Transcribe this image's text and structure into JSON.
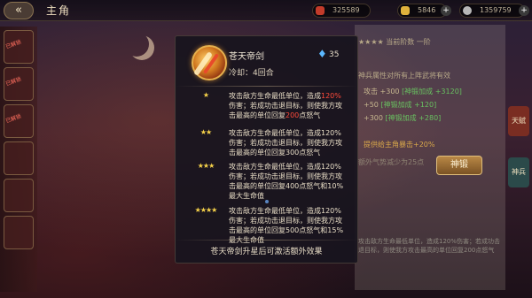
{
  "header": {
    "back_icon": "back-arrow-icon",
    "title": "主角",
    "resources": [
      {
        "name": "power",
        "value": "325589",
        "color": "#c23b2a"
      },
      {
        "name": "gold",
        "value": "5846",
        "color": "#e0b23c"
      },
      {
        "name": "silver",
        "value": "1359759",
        "color": "#b7b7b7"
      }
    ]
  },
  "left_tabs": [
    {
      "tag": "已解锁"
    },
    {
      "tag": "已解锁"
    },
    {
      "tag": "已解锁"
    },
    {
      "tag": ""
    },
    {
      "tag": ""
    },
    {
      "tag": ""
    }
  ],
  "right_panel": {
    "header": "★★★★  当前阶数  一阶",
    "attr_title": "神兵属性对所有上阵武将有效",
    "rows": [
      {
        "label": "攻击 +300",
        "bonus": "[神锻加成 +3120]"
      },
      {
        "label": "+50",
        "bonus": "[神锻加成 +120]"
      },
      {
        "label": "+300",
        "bonus": "[神锻加成 +280]"
      }
    ],
    "note1": "提供给主角暴击+20%",
    "note2": "额外气势减少为25点",
    "shen_duan_button": "神锻",
    "side_tabs": [
      "天赋",
      "神兵"
    ],
    "skill_preview": "攻击敌方生命最低单位，造成120%伤害；若成功击退目标，则使我方攻击最高的单位回复200点怒气"
  },
  "popup": {
    "skill_name": "苍天帝剑",
    "cooldown": "冷却：4回合",
    "spirit_value": "35",
    "tiers": [
      {
        "stars": "★",
        "text_pre": "攻击敌方生命最低单位，造成",
        "pct": "120%",
        "text_mid": "伤害；若成功击退目标，则使我方攻击最高的单位回复",
        "rage": "200",
        "text_post": "点怒气"
      },
      {
        "stars": "★★",
        "text": "攻击敌方生命最低单位，造成120%伤害；若成功击退目标，则使我方攻击最高的单位回复300点怒气"
      },
      {
        "stars": "★★★",
        "text": "攻击敌方生命最低单位，造成120%伤害；若成功击退目标，则使我方攻击最高的单位回复400点怒气和10%最大生命值"
      },
      {
        "stars": "★★★★",
        "text": "攻击敌方生命最低单位，造成120%伤害；若成功击退目标，则使我方攻击最高的单位回复500点怒气和15%最大生命值"
      }
    ],
    "footer": "苍天帝剑升星后可激活额外效果"
  }
}
